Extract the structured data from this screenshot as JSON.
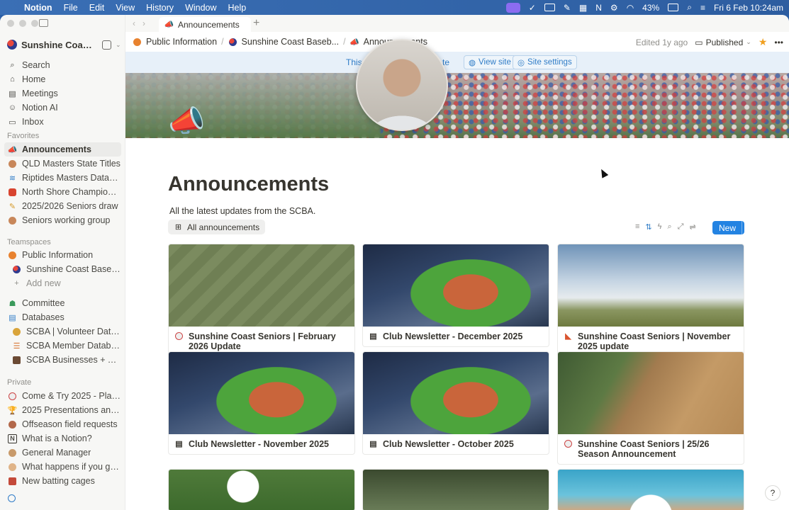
{
  "menubar": {
    "app": "Notion",
    "menus": [
      "File",
      "Edit",
      "View",
      "History",
      "Window",
      "Help"
    ],
    "battery": "43%",
    "datetime": "Fri 6 Feb  10:24am"
  },
  "sidebar": {
    "workspace": "Sunshine Coast Baseb...",
    "nav": [
      {
        "label": "Search",
        "icon": "search-icon"
      },
      {
        "label": "Home",
        "icon": "home-icon"
      },
      {
        "label": "Meetings",
        "icon": "calendar-icon"
      },
      {
        "label": "Notion AI",
        "icon": "ai-face-icon"
      },
      {
        "label": "Inbox",
        "icon": "inbox-icon"
      }
    ],
    "favorites_heading": "Favorites",
    "favorites": [
      {
        "label": "Announcements",
        "icon": "megaphone-icon"
      },
      {
        "label": "QLD Masters State Titles",
        "icon": "cookie-icon"
      },
      {
        "label": "Riptides Masters Database",
        "icon": "waves-icon"
      },
      {
        "label": "North Shore Champions Plate ...",
        "icon": "trophy-icon"
      },
      {
        "label": "2025/2026 Seniors draw",
        "icon": "pencil-icon"
      },
      {
        "label": "Seniors working group",
        "icon": "cookie-icon"
      }
    ],
    "teamspaces_heading": "Teamspaces",
    "teamspaces": [
      {
        "label": "Public Information",
        "icon": "orange-dot-icon"
      },
      {
        "label": "Sunshine Coast Baseball Ass...",
        "icon": "baseball-logo-icon"
      },
      {
        "label": "Add new",
        "icon": "plus-icon"
      },
      {
        "label": "Committee",
        "icon": "people-icon"
      },
      {
        "label": "Databases",
        "icon": "database-icon"
      },
      {
        "label": "SCBA | Volunteer Database",
        "icon": "money-bag-icon"
      },
      {
        "label": "SCBA Member Databases",
        "icon": "list-icon"
      },
      {
        "label": "SCBA Businesses + Trades",
        "icon": "briefcase-icon"
      }
    ],
    "private_heading": "Private",
    "private": [
      {
        "label": "Come & Try 2025 - Planning",
        "icon": "baseball-icon"
      },
      {
        "label": "2025 Presentations and awards",
        "icon": "trophy-icon"
      },
      {
        "label": "Offseason field requests",
        "icon": "cookie-icon"
      },
      {
        "label": "What is a Notion?",
        "icon": "notion-icon"
      },
      {
        "label": "General Manager",
        "icon": "person-icon"
      },
      {
        "label": "What happens if you get eject...",
        "icon": "wave-hand-icon"
      },
      {
        "label": "New batting cages",
        "icon": "cage-icon"
      }
    ]
  },
  "tabs": {
    "active": "Announcements"
  },
  "breadcrumb": [
    {
      "label": "Public Information"
    },
    {
      "label": "Sunshine Coast Baseb..."
    },
    {
      "label": "Announcements"
    }
  ],
  "topbar": {
    "edited": "Edited 1y ago",
    "published": "Published"
  },
  "banner": {
    "text_a": "This",
    "text_b": "te",
    "view_site": "View site",
    "site_settings": "Site settings"
  },
  "page": {
    "icon": "📣",
    "title": "Announcements",
    "description": "All the latest updates from the SCBA.",
    "view_tab": "All announcements",
    "new_button": "New"
  },
  "gallery": [
    {
      "title": "Sunshine Coast Seniors | February 2026 Update",
      "icon": "baseball-icon"
    },
    {
      "title": "Club Newsletter - December 2025",
      "icon": "newspaper-icon"
    },
    {
      "title": "Sunshine Coast Seniors | November 2025 update",
      "icon": "pizza-icon"
    },
    {
      "title": "Club Newsletter - November 2025",
      "icon": "newspaper-icon"
    },
    {
      "title": "Club Newsletter - October 2025",
      "icon": "newspaper-icon"
    },
    {
      "title": "Sunshine Coast Seniors | 25/26 Season Announcement",
      "icon": "baseball-icon"
    }
  ],
  "colors": {
    "accent": "#2383e2",
    "sidebar_bg": "#f7f7f5",
    "banner_bg": "#e7f0f9",
    "menubar": "#3a6fb5"
  }
}
